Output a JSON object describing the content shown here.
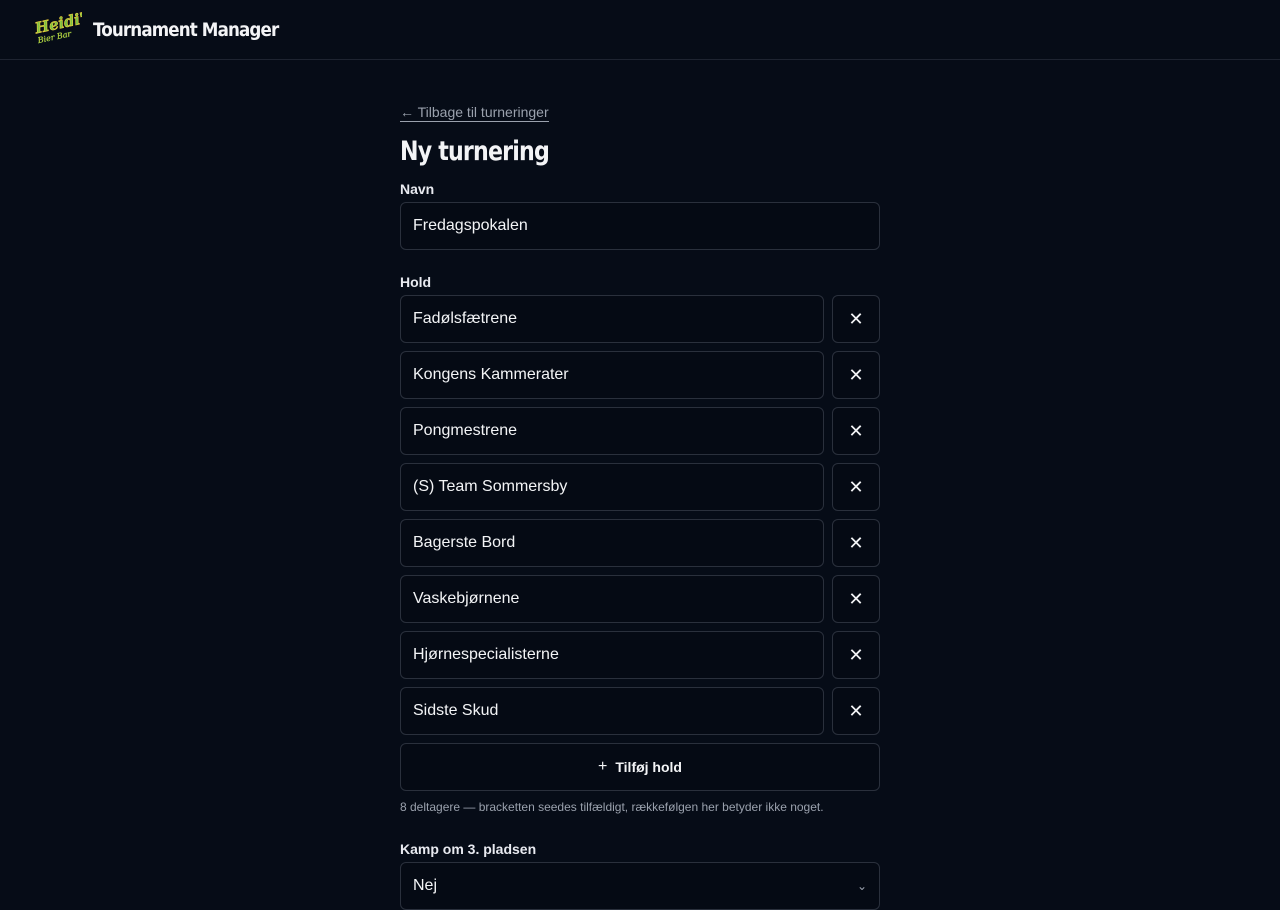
{
  "header": {
    "logo_text": "Heidi's Bier Bar",
    "title": "Tournament Manager"
  },
  "page": {
    "back_link": "← Tilbage til turneringer",
    "title": "Ny turnering"
  },
  "form": {
    "name_label": "Navn",
    "name_value": "Fredagspokalen",
    "teams_label": "Hold",
    "teams": [
      "Fadølsfætrene",
      "Kongens Kammerater",
      "Pongmestrene",
      "(S) Team Sommersby",
      "Bagerste Bord",
      "Vaskebjørnene",
      "Hjørnespecialisterne",
      "Sidste Skud"
    ],
    "remove_icon": "close-icon",
    "add_team_label": "Tilføj hold",
    "participants_hint": "8 deltagere — bracketten seedes tilfældigt, rækkefølgen her betyder ikke noget.",
    "third_place_label": "Kamp om 3. pladsen",
    "third_place_value": "Nej"
  },
  "colors": {
    "background": "#060c17",
    "border": "#2a303c",
    "logo_green": "#7cc242",
    "logo_yellow": "#f2d23c"
  }
}
